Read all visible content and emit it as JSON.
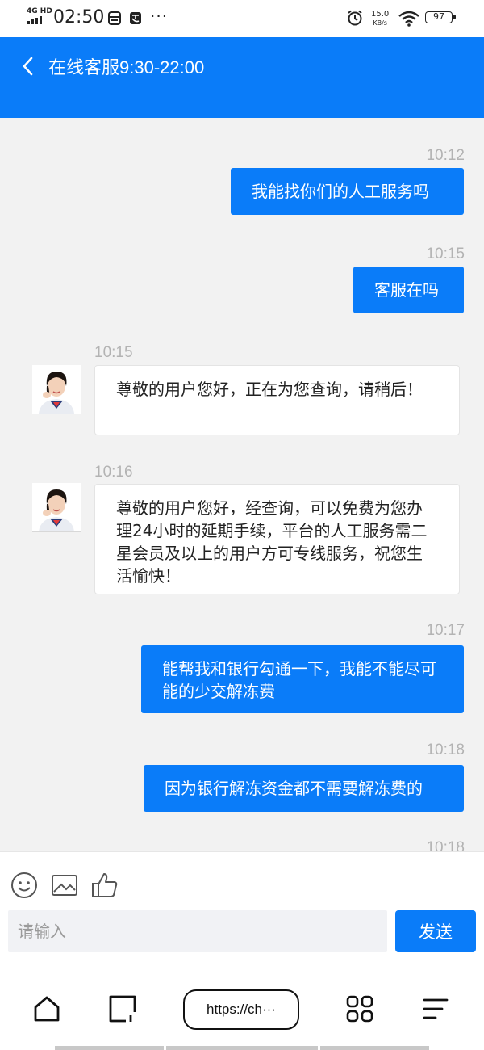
{
  "status_bar": {
    "network": "4G HD",
    "time": "02:50",
    "more": "···",
    "speed_value": "15.0",
    "speed_unit": "KB/s",
    "battery": "97"
  },
  "header": {
    "title": "在线客服9:30-22:00",
    "back_icon": "chevron-left-icon"
  },
  "messages": [
    {
      "side": "out",
      "time": "10:12",
      "text": "我能找你们的人工服务吗"
    },
    {
      "side": "out",
      "time": "10:15",
      "text": "客服在吗"
    },
    {
      "side": "in",
      "time": "10:15",
      "text": "尊敬的用户您好，正在为您查询，请稍后！"
    },
    {
      "side": "in",
      "time": "10:16",
      "text": "尊敬的用户您好，经查询，可以免费为您办理24小时的延期手续，平台的人工服务需二星会员及以上的用户方可专线服务，祝您生活愉快！"
    },
    {
      "side": "out",
      "time": "10:17",
      "text": "能帮我和银行勾通一下，我能不能尽可能的少交解冻费"
    },
    {
      "side": "out",
      "time": "10:18",
      "text": "因为银行解冻资金都不需要解冻费的"
    },
    {
      "side": "out",
      "time": "10:18",
      "text": ""
    }
  ],
  "composer": {
    "tools": [
      "emoji-icon",
      "image-icon",
      "thumbs-up-icon"
    ],
    "placeholder": "请输入",
    "send_label": "发送"
  },
  "browser_bar": {
    "url": "https://ch···",
    "icons": [
      "home-icon",
      "tabs-icon",
      "apps-icon",
      "menu-icon"
    ]
  },
  "colors": {
    "accent": "#0a7cf9",
    "background": "#f2f2f2",
    "timestamp": "#b3b3b3"
  }
}
